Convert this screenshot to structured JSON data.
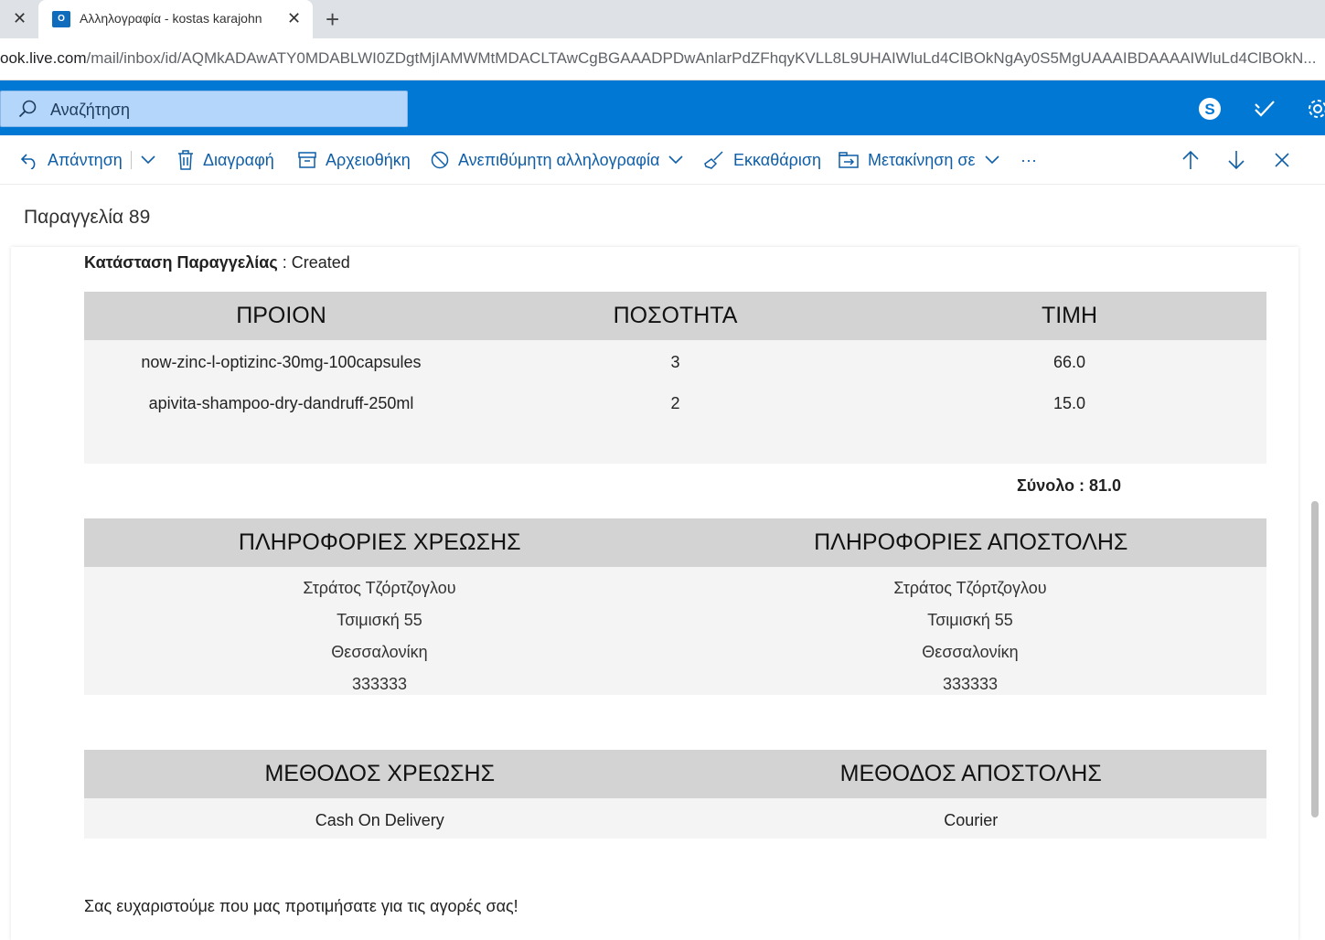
{
  "browser": {
    "active_tab_title": "Αλληλογραφία - kostas karajohn",
    "url_host": "ook.live.com",
    "url_path": "/mail/inbox/id/AQMkADAwATY0MDABLWI0ZDgtMjIAMWMtMDACLTAwCgBGAAADPDwAnlarPdZFhqyKVLL8L9UHAIWluLd4ClBOkNgAy0S5MgUAAAIBDAAAAIWluLd4ClBOkN..."
  },
  "header": {
    "search_placeholder": "Αναζήτηση",
    "icons": [
      "search-icon",
      "skype-icon",
      "todo-icon",
      "settings-icon"
    ]
  },
  "commands": {
    "reply": "Απάντηση",
    "delete": "Διαγραφή",
    "archive": "Αρχειοθήκη",
    "junk": "Ανεπιθύμητη αλληλογραφία",
    "sweep": "Εκκαθάριση",
    "move": "Μετακίνηση σε",
    "more": "···"
  },
  "message": {
    "subject": "Παραγγελία 89",
    "status_label": "Κατάσταση Παραγγελίας",
    "status_value": " : Created",
    "products": {
      "headers": [
        "ΠΡΟΙΟΝ",
        "ΠΟΣΟΤΗΤΑ",
        "ΤΙΜΗ"
      ],
      "rows": [
        [
          "now-zinc-l-optizinc-30mg-100capsules",
          "3",
          "66.0"
        ],
        [
          "apivita-shampoo-dry-dandruff-250ml",
          "2",
          "15.0"
        ]
      ],
      "total": "Σύνολο : 81.0"
    },
    "info": {
      "billing_header": "ΠΛΗΡΟΦΟΡΙΕΣ ΧΡΕΩΣΗΣ",
      "shipping_header": "ΠΛΗΡΟΦΟΡΙΕΣ ΑΠΟΣΤΟΛΗΣ",
      "billing": [
        "Στράτος Τζόρτζογλου",
        "Τσιμισκή 55",
        "Θεσσαλονίκη",
        "333333"
      ],
      "shipping": [
        "Στράτος Τζόρτζογλου",
        "Τσιμισκή 55",
        "Θεσσαλονίκη",
        "333333"
      ]
    },
    "methods": {
      "billing_header": "ΜΕΘΟΔΟΣ ΧΡΕΩΣΗΣ",
      "shipping_header": "ΜΕΘΟΔΟΣ ΑΠΟΣΤΟΛΗΣ",
      "billing_value": "Cash On Delivery",
      "shipping_value": "Courier"
    },
    "thanks": "Σας ευχαριστούμε που μας προτιμήσατε για τις αγορές σας!"
  },
  "colors": {
    "brand": "#0078d4",
    "command_text": "#0f5ea8",
    "table_header": "#d3d3d3",
    "table_body": "#f4f4f4"
  }
}
